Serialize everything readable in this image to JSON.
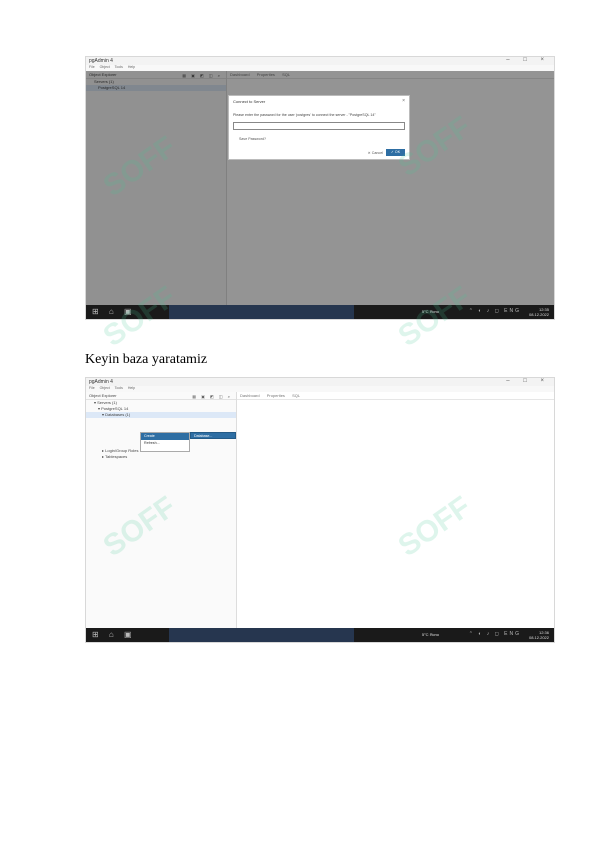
{
  "screenshot1": {
    "titlebar": {
      "app": "pgAdmin 4",
      "controls": "–  □  ×"
    },
    "menu": [
      "File",
      "Object",
      "Tools",
      "Help"
    ],
    "sidebar": {
      "header": "Object Explorer",
      "tools": "▦ ▣ ◩ ◫ ⌕",
      "items": [
        "Servers (1)",
        "PostgreSQL 14"
      ]
    },
    "main": {
      "tabs": [
        "Dashboard",
        "Properties",
        "SQL"
      ]
    },
    "dialog": {
      "title": "Connect to Server",
      "close": "×",
      "message": "Please enter the password for the user 'postgres' to connect the server - \"PostgreSQL 14\"",
      "remember": "Save Password?",
      "cancel": "✕ Cancel",
      "ok": "✓ OK"
    },
    "taskbar": {
      "weather": "5°C Ясно",
      "tray": "⌃ ◐ ♪ ◻ ENG",
      "time": "12:35",
      "date": "08.12.2022"
    }
  },
  "caption": "Keyin baza yaratamiz",
  "screenshot2": {
    "titlebar": {
      "app": "pgAdmin 4",
      "controls": "–  □  ×"
    },
    "menu": [
      "File",
      "Object",
      "Tools",
      "Help"
    ],
    "sidebar": {
      "header": "Object Explorer",
      "tools": "▦ ▣ ◩ ◫ ⌕",
      "items": [
        "▾ Servers (1)",
        "▾ PostgreSQL 14",
        "▾ Databases (1)",
        "▸ Login/Group Roles",
        "▸ Tablespaces"
      ]
    },
    "main": {
      "tabs": [
        "Dashboard",
        "Properties",
        "SQL"
      ]
    },
    "context_menu": {
      "items": [
        "Create",
        "Refresh..."
      ],
      "submenu": "Database..."
    },
    "taskbar": {
      "weather": "5°C Ясно",
      "tray": "⌃ ◐ ♪ ◻ ENG",
      "time": "12:36",
      "date": "08.12.2022"
    }
  }
}
